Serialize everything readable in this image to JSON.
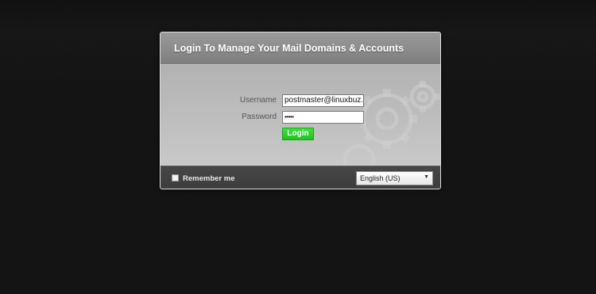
{
  "header": {
    "title": "Login To Manage Your Mail Domains & Accounts"
  },
  "form": {
    "username_label": "Username",
    "username_value": "postmaster@linuxbuz.c",
    "password_label": "Password",
    "password_value": "•••••",
    "login_label": "Login"
  },
  "footer": {
    "remember_label": "Remember me",
    "remember_checked": false,
    "language_value": "English (US)",
    "language_arrow": "▼"
  },
  "colors": {
    "page_background": "#333333",
    "header_gradient_top": "#9a9a9a",
    "body_background": "#bfbfbf",
    "footer_background": "#424242",
    "login_button": "#22c822"
  },
  "icons": {
    "gears": "gears-decoration-icon",
    "dropdown": "chevron-down-icon"
  }
}
